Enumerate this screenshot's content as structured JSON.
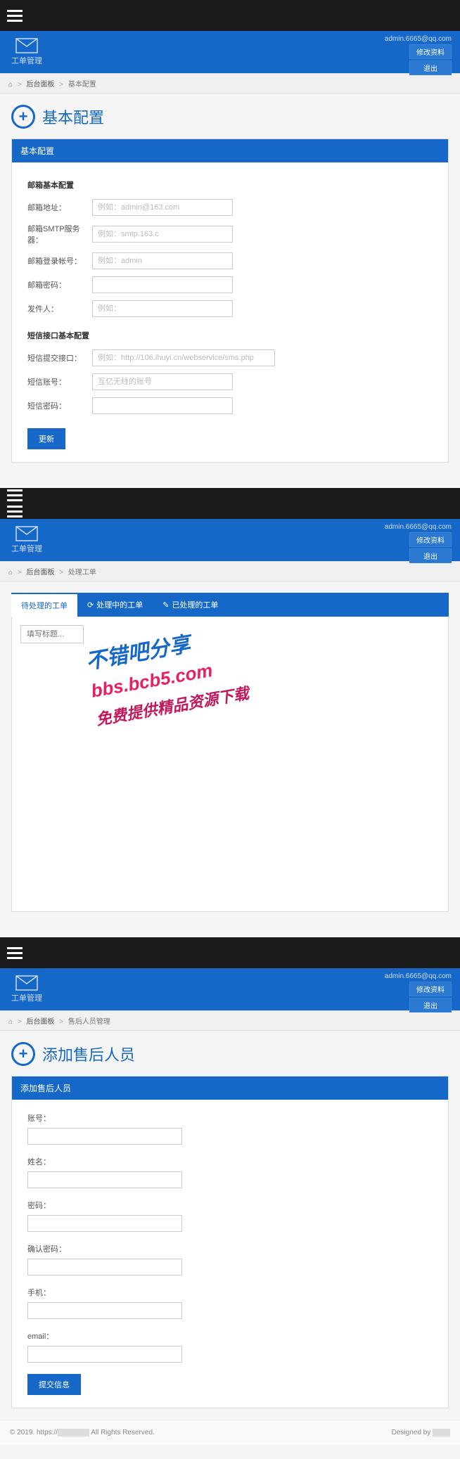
{
  "common": {
    "brand_title": "工单管理",
    "user_email": "admin.6665@qq.com",
    "btn_profile": "修改资料",
    "btn_logout": "退出",
    "bc_home": "首页",
    "bc_panel": "后台面板",
    "sep": ">"
  },
  "screen1": {
    "bc_current": "基本配置",
    "title": "基本配置",
    "panel_head": "基本配置",
    "sec1": "邮箱基本配置",
    "fields1": [
      {
        "label": "邮箱地址：",
        "ph": "例如：admin@163.com"
      },
      {
        "label": "邮箱SMTP服务器：",
        "ph": "例如：smtp.163.c"
      },
      {
        "label": "邮箱登录帐号：",
        "ph": "例如：admin"
      },
      {
        "label": "邮箱密码：",
        "ph": ""
      },
      {
        "label": "发件人：",
        "ph": "例如："
      }
    ],
    "sec2": "短信接口基本配置",
    "fields2": [
      {
        "label": "短信提交接口：",
        "ph": "例如：http://106.ihuyi.cn/webservice/sms.php"
      },
      {
        "label": "短信账号：",
        "ph": "互亿无线的账号"
      },
      {
        "label": "短信密码：",
        "ph": ""
      }
    ],
    "btn_update": "更新"
  },
  "screen2": {
    "bc_current": "处理工单",
    "tabs": [
      {
        "label": "待处理的工单"
      },
      {
        "label": "处理中的工单"
      },
      {
        "label": "已处理的工单"
      }
    ],
    "search_ph": "填写标题...",
    "wm1": "不错吧分享",
    "wm2": "bbs.bcb5.com",
    "wm3": "免费提供精品资源下载"
  },
  "screen3": {
    "bc_current": "售后人员管理",
    "title": "添加售后人员",
    "panel_head": "添加售后人员",
    "fields": [
      {
        "label": "账号："
      },
      {
        "label": "姓名："
      },
      {
        "label": "密码："
      },
      {
        "label": "确认密码："
      },
      {
        "label": "手机："
      },
      {
        "label": "email："
      }
    ],
    "btn_submit": "提交信息"
  },
  "footer": {
    "left_prefix": "© 2019. https://",
    "left_suffix": " All Rights Reserved.",
    "right": "Designed by"
  }
}
